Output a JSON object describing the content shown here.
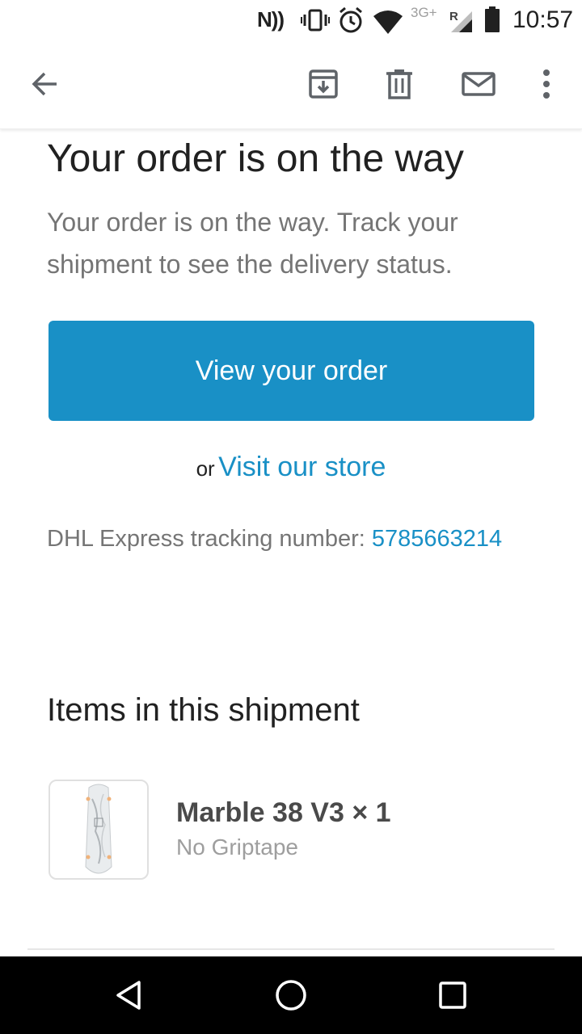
{
  "status_bar": {
    "nfc_label": "N))",
    "network_label": "3G+",
    "roaming_label": "R",
    "time": "10:57"
  },
  "toolbar": {
    "back_icon": "arrow-left",
    "archive_icon": "archive-box",
    "delete_icon": "trash-can",
    "mark_unread_icon": "envelope",
    "more_icon": "vertical-ellipsis"
  },
  "email": {
    "title": "Your order is on the way",
    "subtitle": "Your order is on the way. Track your shipment to see the delivery status.",
    "view_order_button": "View your order",
    "or_text": "or",
    "visit_store_link": "Visit our store",
    "tracking_label": "DHL Express tracking number:",
    "tracking_number": "5785663214",
    "items_heading": "Items in this shipment",
    "items": [
      {
        "name": "Marble 38 V3 × 1",
        "variant": "No Griptape"
      }
    ]
  },
  "nav_bar": {
    "back_icon": "triangle-back",
    "home_icon": "circle-home",
    "recents_icon": "square-recents"
  },
  "colors": {
    "accent": "#1990c6",
    "muted_text": "#757575",
    "primary_text": "#212121"
  }
}
